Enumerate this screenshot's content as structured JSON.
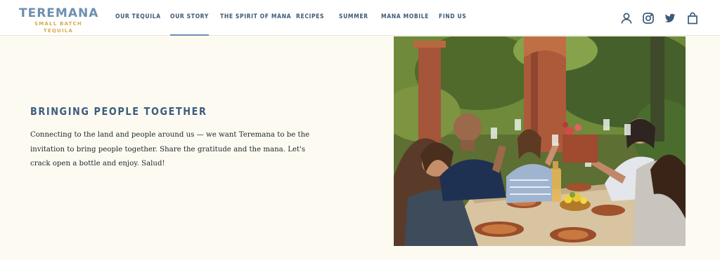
{
  "brand": {
    "name": "TEREMANA",
    "tagline": "SMALL BATCH TEQUILA"
  },
  "nav": {
    "items": [
      {
        "label": "OUR TEQUILA"
      },
      {
        "label": "OUR STORY",
        "active": true
      },
      {
        "label": "THE SPIRIT OF MANA"
      },
      {
        "label": "RECIPES"
      },
      {
        "label": "SUMMER"
      },
      {
        "label": "MANA MOBILE"
      },
      {
        "label": "FIND US"
      }
    ]
  },
  "header_icons": [
    "account-icon",
    "instagram-icon",
    "twitter-icon",
    "cart-bag-icon"
  ],
  "section": {
    "heading": "BRINGING PEOPLE TOGETHER",
    "body": "Connecting to the land and people around us — we want Teremana to be the invitation to bring people together. Share the gratitude and the mana. Let's crack open a bottle and enjoy. Salud!"
  },
  "colors": {
    "background": "#fdfbf1",
    "brand_blue": "#6d8faf",
    "brand_gold": "#d7ab4a",
    "nav_text": "#3c5a78",
    "heading": "#3c5e80"
  }
}
